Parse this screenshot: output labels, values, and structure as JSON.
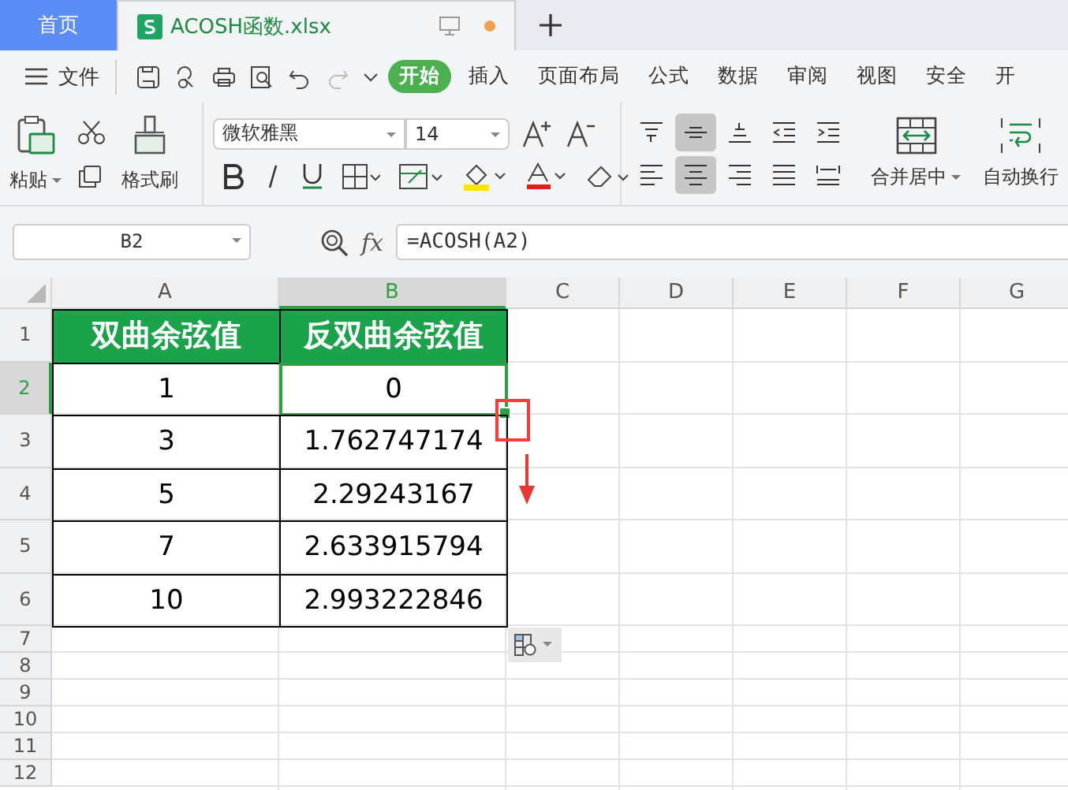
{
  "tabs": [
    {
      "label": "首页",
      "kind": "home",
      "selected": false
    },
    {
      "label": "ACOSH函数.xlsx",
      "kind": "doc",
      "selected": true
    }
  ],
  "menu": {
    "file": "文件",
    "items": [
      {
        "label": "开始",
        "selected": true
      },
      {
        "label": "插入",
        "selected": false
      },
      {
        "label": "页面布局",
        "selected": false
      },
      {
        "label": "公式",
        "selected": false
      },
      {
        "label": "数据",
        "selected": false
      },
      {
        "label": "审阅",
        "selected": false
      },
      {
        "label": "视图",
        "selected": false
      },
      {
        "label": "安全",
        "selected": false
      },
      {
        "label": "开",
        "selected": false
      }
    ]
  },
  "toolbar": {
    "paste": "粘贴",
    "format_painter": "格式刷",
    "font": "微软雅黑",
    "size": "14",
    "align": [
      {
        "kind": "top",
        "selected": false
      },
      {
        "kind": "middle",
        "selected": true
      },
      {
        "kind": "bottom",
        "selected": false
      },
      {
        "kind": "outdent",
        "selected": false
      },
      {
        "kind": "indent",
        "selected": false
      },
      {
        "kind": "left",
        "selected": false
      },
      {
        "kind": "center",
        "selected": true
      },
      {
        "kind": "right",
        "selected": false
      },
      {
        "kind": "justify",
        "selected": false
      },
      {
        "kind": "distribute",
        "selected": false
      }
    ],
    "merge": "合并居中",
    "wrap": "自动换行"
  },
  "formula_bar": {
    "name_box": "B2",
    "fx": "fx",
    "formula": "=ACOSH(A2)"
  },
  "sheet": {
    "columns": [
      {
        "label": "A",
        "selected": false
      },
      {
        "label": "B",
        "selected": true
      },
      {
        "label": "C",
        "selected": false
      },
      {
        "label": "D",
        "selected": false
      },
      {
        "label": "E",
        "selected": false
      },
      {
        "label": "F",
        "selected": false
      },
      {
        "label": "G",
        "selected": false
      }
    ],
    "rows": [
      {
        "label": "1",
        "selected": false,
        "kind": "header",
        "cells": [
          "双曲余弦值",
          "反双曲余弦值"
        ]
      },
      {
        "label": "2",
        "selected": true,
        "kind": "data",
        "cells": [
          "1",
          "0"
        ]
      },
      {
        "label": "3",
        "selected": false,
        "kind": "data",
        "cells": [
          "3",
          "1.762747174"
        ]
      },
      {
        "label": "4",
        "selected": false,
        "kind": "data",
        "cells": [
          "5",
          "2.29243167"
        ]
      },
      {
        "label": "5",
        "selected": false,
        "kind": "data",
        "cells": [
          "7",
          "2.633915794"
        ]
      },
      {
        "label": "6",
        "selected": false,
        "kind": "data",
        "cells": [
          "10",
          "2.993222846"
        ]
      },
      {
        "label": "7",
        "selected": false,
        "kind": "empty",
        "cells": []
      },
      {
        "label": "8",
        "selected": false,
        "kind": "empty",
        "cells": []
      },
      {
        "label": "9",
        "selected": false,
        "kind": "empty",
        "cells": []
      },
      {
        "label": "10",
        "selected": false,
        "kind": "empty",
        "cells": []
      },
      {
        "label": "11",
        "selected": false,
        "kind": "empty",
        "cells": []
      },
      {
        "label": "12",
        "selected": false,
        "kind": "empty",
        "cells": []
      }
    ]
  }
}
